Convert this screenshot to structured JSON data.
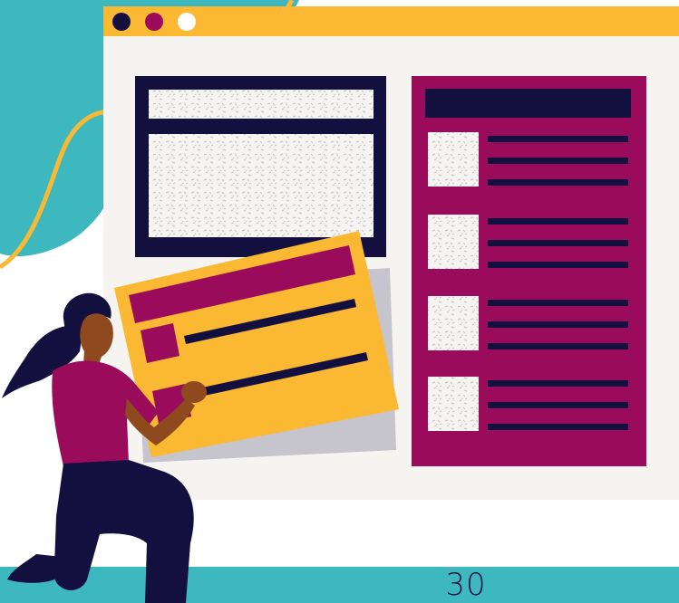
{
  "page": {
    "number": "30"
  },
  "colors": {
    "teal": "#3DB8BE",
    "yellow": "#FBB832",
    "navy": "#13103F",
    "magenta": "#9A0B5C",
    "cream": "#F6F4F0",
    "white": "#FFFFFF",
    "grey": "#C6C4CC",
    "skin": "#8E4A1E"
  },
  "illustration": {
    "browser_dots": [
      "navy",
      "magenta",
      "white"
    ],
    "list_rows": 4
  }
}
